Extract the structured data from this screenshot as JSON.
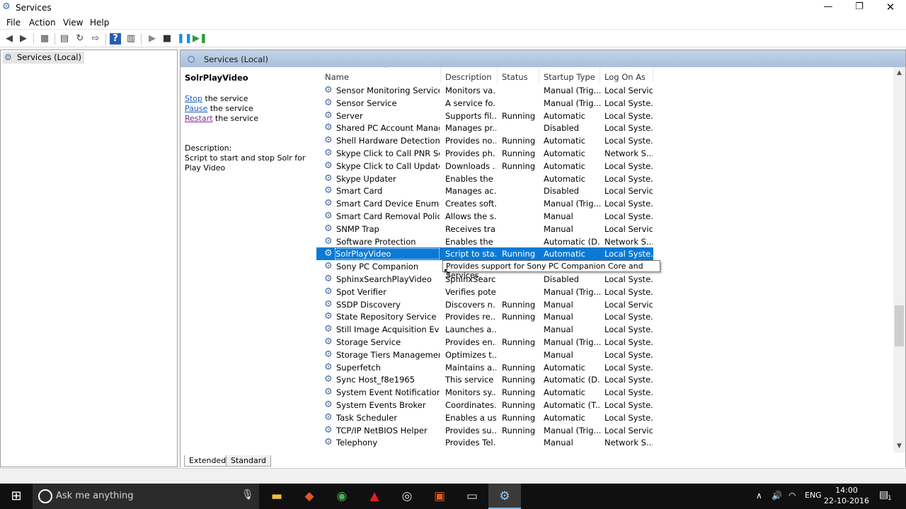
{
  "window": {
    "title": "Services",
    "controls": {
      "minimize": "—",
      "maximize": "❐",
      "close": "✕"
    }
  },
  "menu": [
    "File",
    "Action",
    "View",
    "Help"
  ],
  "tree": {
    "root_label": "Services (Local)"
  },
  "pane": {
    "header": "Services (Local)",
    "selected_service": "SolrPlayVideo",
    "actions": [
      {
        "link": "Stop",
        "suffix": " the service"
      },
      {
        "link": "Pause",
        "suffix": " the service"
      },
      {
        "link": "Restart",
        "suffix": " the service"
      }
    ],
    "description_label": "Description:",
    "description_text": "Script to start and stop Solr for Play Video"
  },
  "columns": [
    "Name",
    "Description",
    "Status",
    "Startup Type",
    "Log On As"
  ],
  "rows": [
    [
      "Sensor Monitoring Service",
      "Monitors va...",
      "",
      "Manual (Trig...",
      "Local Service"
    ],
    [
      "Sensor Service",
      "A service fo...",
      "",
      "Manual (Trig...",
      "Local Syste..."
    ],
    [
      "Server",
      "Supports fil...",
      "Running",
      "Automatic",
      "Local Syste..."
    ],
    [
      "Shared PC Account Manager",
      "Manages pr...",
      "",
      "Disabled",
      "Local Syste..."
    ],
    [
      "Shell Hardware Detection",
      "Provides no...",
      "Running",
      "Automatic",
      "Local Syste..."
    ],
    [
      "Skype Click to Call PNR Ser...",
      "Provides ph...",
      "Running",
      "Automatic",
      "Network S..."
    ],
    [
      "Skype Click to Call Updater",
      "Downloads ...",
      "Running",
      "Automatic",
      "Local Syste..."
    ],
    [
      "Skype Updater",
      "Enables the ...",
      "",
      "Automatic",
      "Local Syste..."
    ],
    [
      "Smart Card",
      "Manages ac...",
      "",
      "Disabled",
      "Local Service"
    ],
    [
      "Smart Card Device Enumera...",
      "Creates soft...",
      "",
      "Manual (Trig...",
      "Local Syste..."
    ],
    [
      "Smart Card Removal Policy",
      "Allows the s...",
      "",
      "Manual",
      "Local Syste..."
    ],
    [
      "SNMP Trap",
      "Receives tra...",
      "",
      "Manual",
      "Local Service"
    ],
    [
      "Software Protection",
      "Enables the ...",
      "",
      "Automatic (D...",
      "Network S..."
    ],
    [
      "SolrPlayVideo",
      "Script to sta...",
      "Running",
      "Automatic",
      "Local Syste..."
    ],
    [
      "Sony PC Companion",
      "",
      "",
      "",
      ""
    ],
    [
      "SphinxSearchPlayVideo",
      "SphinxSearc...",
      "",
      "Disabled",
      "Local Syste..."
    ],
    [
      "Spot Verifier",
      "Verifies pote...",
      "",
      "Manual (Trig...",
      "Local Syste..."
    ],
    [
      "SSDP Discovery",
      "Discovers n...",
      "Running",
      "Manual",
      "Local Service"
    ],
    [
      "State Repository Service",
      "Provides re...",
      "Running",
      "Manual",
      "Local Syste..."
    ],
    [
      "Still Image Acquisition Events",
      "Launches a...",
      "",
      "Manual",
      "Local Syste..."
    ],
    [
      "Storage Service",
      "Provides en...",
      "Running",
      "Manual (Trig...",
      "Local Syste..."
    ],
    [
      "Storage Tiers Management",
      "Optimizes t...",
      "",
      "Manual",
      "Local Syste..."
    ],
    [
      "Superfetch",
      "Maintains a...",
      "Running",
      "Automatic",
      "Local Syste..."
    ],
    [
      "Sync Host_f8e1965",
      "This service ...",
      "Running",
      "Automatic (D...",
      "Local Syste..."
    ],
    [
      "System Event Notification S...",
      "Monitors sy...",
      "Running",
      "Automatic",
      "Local Syste..."
    ],
    [
      "System Events Broker",
      "Coordinates...",
      "Running",
      "Automatic (T...",
      "Local Syste..."
    ],
    [
      "Task Scheduler",
      "Enables a us...",
      "Running",
      "Automatic",
      "Local Syste..."
    ],
    [
      "TCP/IP NetBIOS Helper",
      "Provides su...",
      "Running",
      "Manual (Trig...",
      "Local Service"
    ],
    [
      "Telephony",
      "Provides Tel...",
      "",
      "Manual",
      "Network S..."
    ]
  ],
  "selected_row": 13,
  "tooltip": "Provides support for Sony PC Companion Core and Services.",
  "tabs": [
    "Extended",
    "Standard"
  ],
  "taskbar": {
    "search_placeholder": "Ask me anything",
    "language": "ENG",
    "time": "14:00",
    "date": "22-10-2016",
    "notification_count": "1"
  },
  "colors": {
    "selection": "#0a7ad6",
    "header_gradient_top": "#c4d3e8",
    "taskbar": "#101010"
  }
}
